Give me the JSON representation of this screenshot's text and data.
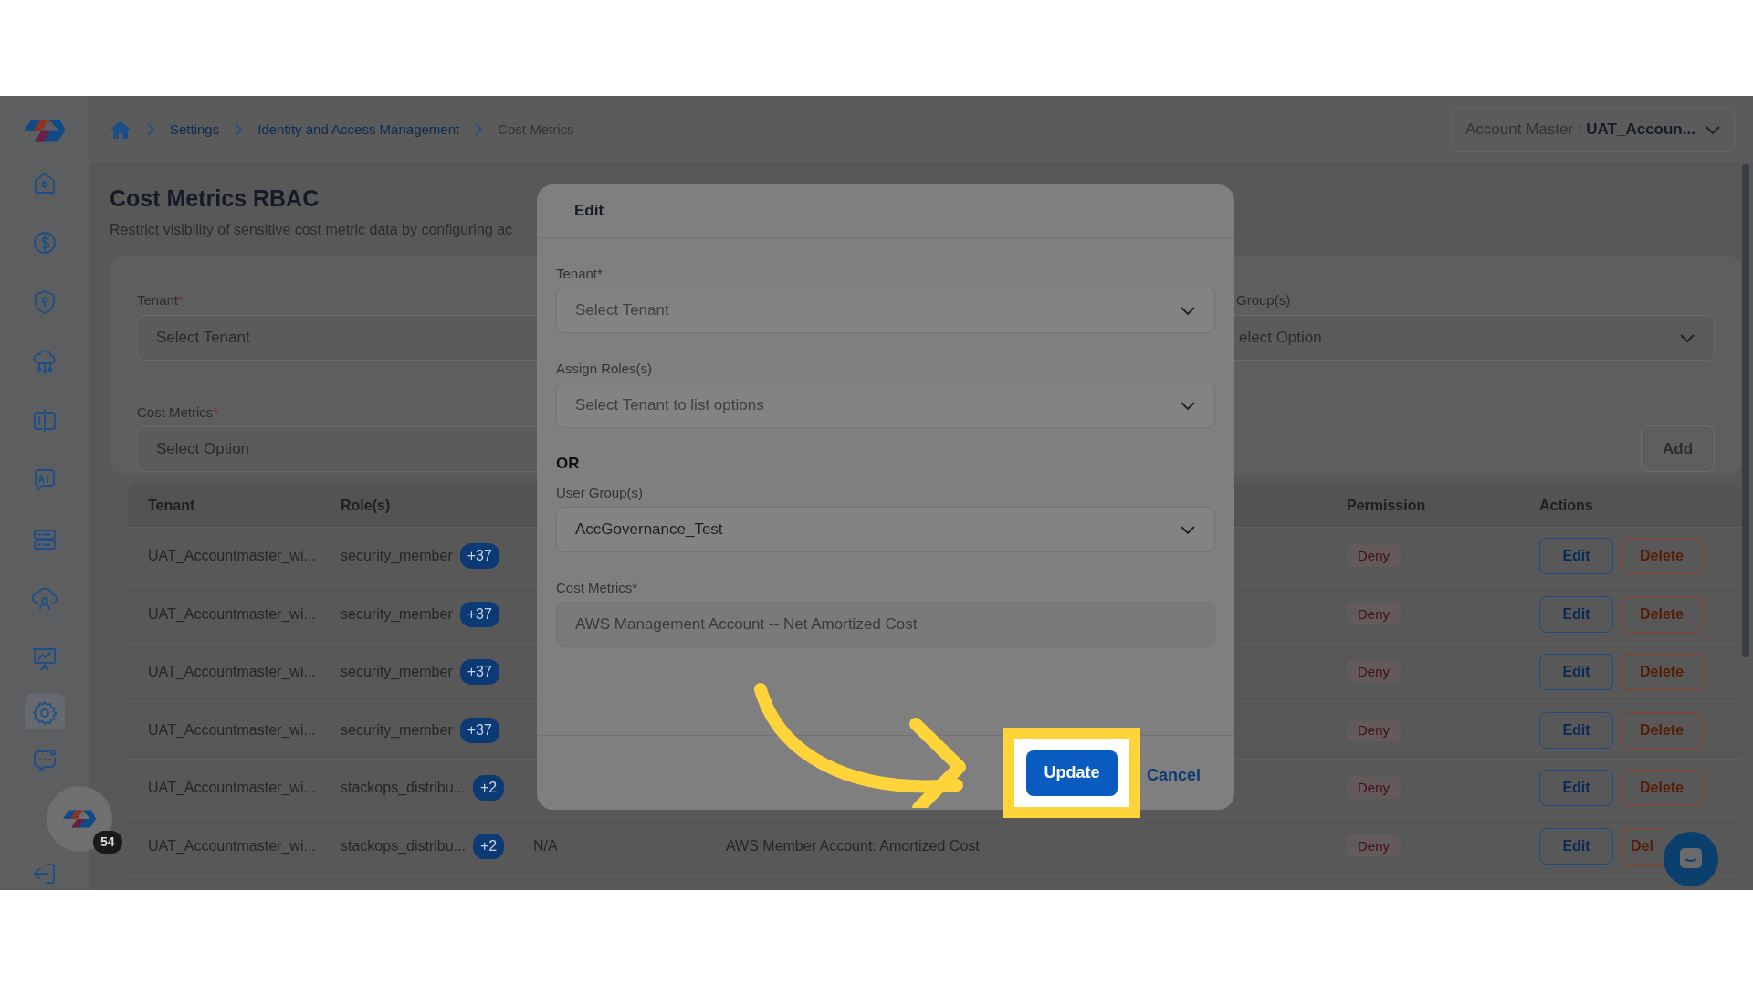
{
  "breadcrumb": [
    {
      "label": "Settings",
      "current": false
    },
    {
      "label": "Identity and Access Management",
      "current": false
    },
    {
      "label": "Cost Metrics",
      "current": true
    }
  ],
  "account_selector": {
    "label": "Account Master :",
    "value": "UAT_Accoun..."
  },
  "page": {
    "title": "Cost Metrics RBAC",
    "subtitle": "Restrict visibility of sensitive cost metric data by configuring ac"
  },
  "form": {
    "fields": [
      {
        "label": "Tenant",
        "mark": "*",
        "placeholder": "Select Tenant"
      },
      {
        "label": "Cost Metrics",
        "mark": "*",
        "placeholder": "Select Option"
      }
    ],
    "right_fields": [
      {
        "label": "Group(s)",
        "placeholder": "elect Option"
      }
    ],
    "add_button": "Add"
  },
  "table": {
    "columns": [
      "Tenant",
      "Role(s)",
      "Permission",
      "Actions"
    ],
    "rows": [
      {
        "tenant": "UAT_Accountmaster_wi...",
        "role": "security_member",
        "role_count": "+37",
        "permission": "Deny",
        "actions": [
          "Edit",
          "Delete"
        ]
      },
      {
        "tenant": "UAT_Accountmaster_wi...",
        "role": "security_member",
        "role_count": "+37",
        "permission": "Deny",
        "actions": [
          "Edit",
          "Delete"
        ]
      },
      {
        "tenant": "UAT_Accountmaster_wi...",
        "role": "security_member",
        "role_count": "+37",
        "permission": "Deny",
        "actions": [
          "Edit",
          "Delete"
        ]
      },
      {
        "tenant": "UAT_Accountmaster_wi...",
        "role": "security_member",
        "role_count": "+37",
        "permission": "Deny",
        "actions": [
          "Edit",
          "Delete"
        ]
      },
      {
        "tenant": "UAT_Accountmaster_wi...",
        "role": "stackops_distribu...",
        "role_count": "+2",
        "permission": "Deny",
        "actions": [
          "Edit",
          "Delete"
        ]
      },
      {
        "tenant": "UAT_Accountmaster_wi...",
        "role": "stackops_distribu...",
        "role_count": "+2",
        "column_3": "N/A",
        "column_4": "AWS Member Account: Amortized Cost",
        "permission": "Deny",
        "actions": [
          "Edit",
          "Del"
        ]
      }
    ]
  },
  "modal": {
    "title": "Edit",
    "fields": [
      {
        "kind": "select",
        "label": "Tenant",
        "mark": "*",
        "placeholder": "Select Tenant"
      },
      {
        "kind": "select",
        "label": "Assign Roles(s)",
        "placeholder": "Select Tenant to list options"
      },
      {
        "kind": "separator",
        "text": "OR"
      },
      {
        "kind": "select",
        "label": "User Group(s)",
        "value": "AccGovernance_Test"
      },
      {
        "kind": "text",
        "label": "Cost Metrics",
        "mark": "*",
        "value": "AWS Management Account -- Net Amortized Cost",
        "disabled": true
      }
    ],
    "buttons": [
      {
        "kind": "primary",
        "label": "Update",
        "highlighted": true
      },
      {
        "kind": "link",
        "label": "Cancel"
      }
    ]
  },
  "notification_badge": "54"
}
